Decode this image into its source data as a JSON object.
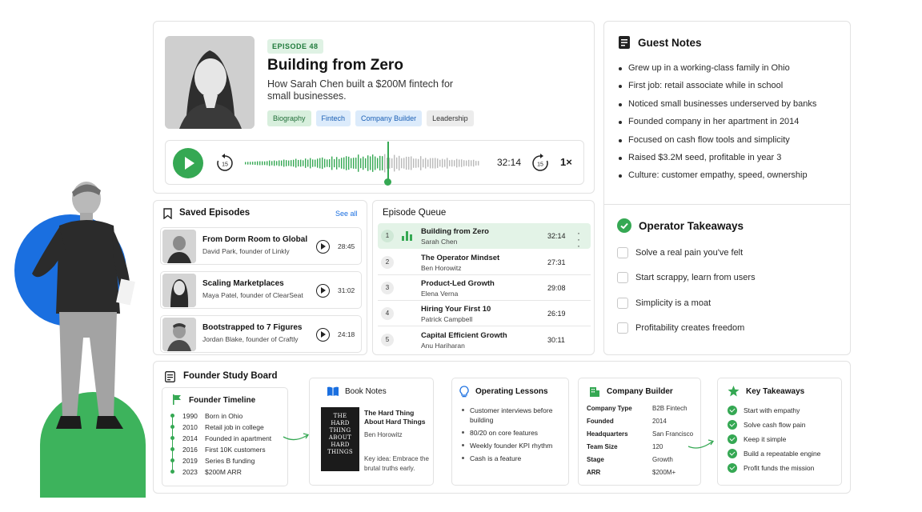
{
  "episode": {
    "badge": "EPISODE 48",
    "title": "Building from Zero",
    "subtitle": "How Sarah Chen built a $200M fintech for small businesses.",
    "tags": [
      "Biography",
      "Fintech",
      "Company Builder",
      "Leadership"
    ],
    "player": {
      "elapsed": "32:14",
      "skip_back": "15",
      "skip_forward": "15",
      "speed": "1×"
    }
  },
  "guest_notes": {
    "title": "Guest Notes",
    "items": [
      "Grew up in a working-class family in Ohio",
      "First job: retail associate while in school",
      "Noticed small businesses underserved by banks",
      "Founded company in her apartment in 2014",
      "Focused on cash flow tools and simplicity",
      "Raised $3.2M seed, profitable in year 3",
      "Culture: customer empathy, speed, ownership"
    ]
  },
  "takeaways": {
    "title": "Operator Takeaways",
    "items": [
      "Solve a real pain you've felt",
      "Start scrappy, learn from users",
      "Simplicity is a moat",
      "Profitability creates freedom"
    ]
  },
  "saved": {
    "title": "Saved Episodes",
    "see_all": "See all",
    "items": [
      {
        "title": "From Dorm Room to Global",
        "subtitle": "David Park, founder of Linkly",
        "duration": "28:45"
      },
      {
        "title": "Scaling Marketplaces",
        "subtitle": "Maya Patel, founder of ClearSeat",
        "duration": "31:02"
      },
      {
        "title": "Bootstrapped to 7 Figures",
        "subtitle": "Jordan Blake, founder of Craftly",
        "duration": "24:18"
      }
    ]
  },
  "queue": {
    "title": "Episode Queue",
    "items": [
      {
        "num": "1",
        "title": "Building from Zero",
        "guest": "Sarah Chen",
        "duration": "32:14"
      },
      {
        "num": "2",
        "title": "The Operator Mindset",
        "guest": "Ben Horowitz",
        "duration": "27:31"
      },
      {
        "num": "3",
        "title": "Product-Led Growth",
        "guest": "Elena Verna",
        "duration": "29:08"
      },
      {
        "num": "4",
        "title": "Hiring Your First 10",
        "guest": "Patrick Campbell",
        "duration": "26:19"
      },
      {
        "num": "5",
        "title": "Capital Efficient Growth",
        "guest": "Anu Hariharan",
        "duration": "30:11"
      }
    ]
  },
  "board": {
    "title": "Founder Study Board",
    "timeline": {
      "title": "Founder Timeline",
      "items": [
        {
          "year": "1990",
          "event": "Born in Ohio"
        },
        {
          "year": "2010",
          "event": "Retail job in college"
        },
        {
          "year": "2014",
          "event": "Founded in apartment"
        },
        {
          "year": "2016",
          "event": "First 10K customers"
        },
        {
          "year": "2019",
          "event": "Series B funding"
        },
        {
          "year": "2023",
          "event": "$200M ARR"
        }
      ]
    },
    "book": {
      "title": "Book Notes",
      "cover": [
        "THE",
        "HARD",
        "THING",
        "ABOUT",
        "HARD",
        "THINGS"
      ],
      "book_title": "The Hard Thing About Hard Things",
      "author": "Ben Horowitz",
      "key_idea": "Key idea: Embrace the brutal truths early."
    },
    "lessons": {
      "title": "Operating Lessons",
      "items": [
        "Customer interviews before building",
        "80/20 on core features",
        "Weekly founder KPI rhythm",
        "Cash is a feature"
      ]
    },
    "company": {
      "title": "Company Builder",
      "rows": [
        {
          "key": "Company Type",
          "value": "B2B Fintech"
        },
        {
          "key": "Founded",
          "value": "2014"
        },
        {
          "key": "Headquarters",
          "value": "San Francisco"
        },
        {
          "key": "Team Size",
          "value": "120"
        },
        {
          "key": "Stage",
          "value": "Growth"
        },
        {
          "key": "ARR",
          "value": "$200M+"
        }
      ]
    },
    "key_takeaways": {
      "title": "Key Takeaways",
      "items": [
        "Start with empathy",
        "Solve cash flow pain",
        "Keep it simple",
        "Build a repeatable engine",
        "Profit funds the mission"
      ]
    }
  },
  "colors": {
    "accent_green": "#35a853",
    "accent_blue": "#1a6fe0"
  }
}
